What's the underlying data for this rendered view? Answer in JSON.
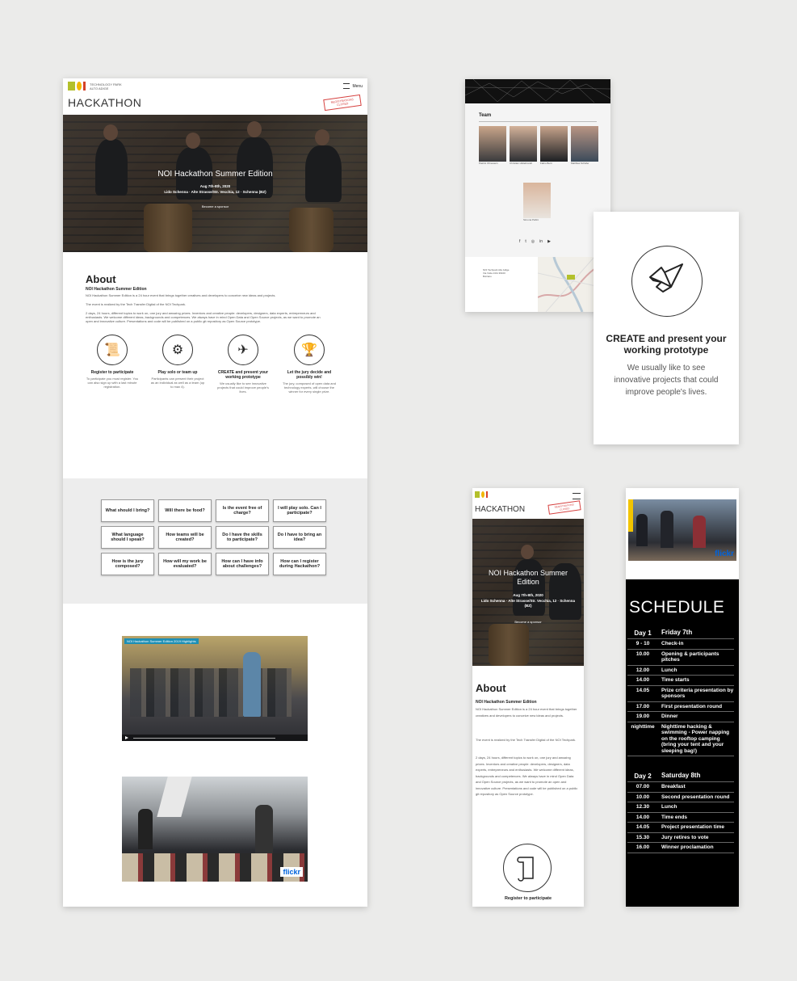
{
  "desktop": {
    "logo_text": "TECHNOLOGY PARK ALTO ADIGE",
    "menu_label": "Menu",
    "title": "HACKATHON",
    "stamp": "REGISTRATIONS CLOSED",
    "hero": {
      "headline": "NOI Hackathon Summer Edition",
      "date": "Aug 7th-8th, 2020",
      "location": "Lido Schenna · Alte Strasse/Str. Vecchia, 12 · Schenna (BZ)",
      "cta": "Become a sponsor"
    },
    "about": {
      "heading": "About",
      "subheading": "NOI Hackathon Summer Edition",
      "p1": "NOI Hackathon Summer Edition is a 24 hour event that brings together creatives and developers to conceive new ideas and projects.",
      "p2": "The event is realized by the Tech Transfer Digital of the NOI Techpark.",
      "p3": "2 days, 24 hours, different topics to work on, one jury and amazing prizes. Inventors and creative people: developers, designers, data experts, entrepreneurs and enthusiasts. We welcome different ideas, backgrounds and competences. We always have in mind Open Data and Open Source projects, as we want to promote an open and innovative culture. Presentations and code will be published on a public git repository as Open Source prototype."
    },
    "features": [
      {
        "icon": "scroll-icon",
        "glyph": "📜",
        "title": "Register to participate",
        "desc": "To participate you must register. You can also sign up with a last minute registration."
      },
      {
        "icon": "robot-icon",
        "glyph": "⚙",
        "title": "Play solo or team up",
        "desc": "Participants can present their project as an individual as well as a team (up to max 4)."
      },
      {
        "icon": "origami-bird-icon",
        "glyph": "✈",
        "title": "CREATE and present your working prototype",
        "desc": "We usually like to see innovative projects that could improve people's lives."
      },
      {
        "icon": "trophy-icon",
        "glyph": "🏆",
        "title": "Let the jury decide and possibly win!",
        "desc": "The jury, composed of open data and technology experts, will choose the winner for every single prize."
      }
    ],
    "faq": [
      "What should I bring?",
      "Will there be food?",
      "Is the event free of charge?",
      "I will play solo. Can I participate?",
      "What language should I speak?",
      "How teams will be created?",
      "Do I have the skills to participate?",
      "Do I have to bring an idea?",
      "How is the jury composed?",
      "How will my work be evaluated?",
      "How can I have info about challenges?",
      "How can I register during Hackathon?"
    ],
    "video_title": "NOI Hackathon Summer Edition 2019 Highlights",
    "flickr": "flickr"
  },
  "team": {
    "heading": "Team",
    "members": [
      "Patrick Ohnewein",
      "Christian Hildebrandt",
      "Fabio Berti",
      "Matthias Schäfer"
    ],
    "member5": "Simona Pellini",
    "address": "NOI Techpark Alto Adige Via Volta 13/A 39100 Bolzano"
  },
  "feature_card": {
    "icon": "origami-bird-icon",
    "title": "CREATE and present your working prototype",
    "desc": "We usually like to see innovative projects that could improve people's lives."
  },
  "mobile": {
    "title": "HACKATHON",
    "stamp": "REGISTRATIONS CLOSED",
    "headline": "NOI Hackathon Summer Edition",
    "date": "Aug 7th-8th, 2020",
    "location": "Lido Schenna · Alte Strasse/Str. Vecchia, 12 · Schenna (BZ)",
    "cta": "Become a sponsor",
    "about_heading": "About",
    "about_sub": "NOI Hackathon Summer Edition",
    "about_p1": "NOI Hackathon Summer Edition is a 24 hour event that brings together creatives and developers to conceive new ideas and projects.",
    "about_p2": "The event is realized by the Tech Transfer Digital of the NOI Techpark.",
    "about_p3": "2 days, 24 hours, different topics to work on, one jury and amazing prizes. Inventors and creative people: developers, designers, data experts, entrepreneurs and enthusiasts. We welcome different ideas, backgrounds and competences. We always have in mind Open Data and Open Source projects, as we want to promote an open and innovative culture. Presentations and code will be published on a public git repository as Open Source prototype.",
    "register_label": "Register to participate"
  },
  "schedule": {
    "flickr": "flickr",
    "heading": "SCHEDULE",
    "day1": {
      "label": "Day 1",
      "date": "Friday 7th"
    },
    "day1_rows": [
      {
        "time": "9 - 10",
        "event": "Check-in"
      },
      {
        "time": "10.00",
        "event": "Opening & participants pitches"
      },
      {
        "time": "12.00",
        "event": "Lunch"
      },
      {
        "time": "14.00",
        "event": "Time starts"
      },
      {
        "time": "14.05",
        "event": "Prize criteria presentation by sponsors"
      },
      {
        "time": "17.00",
        "event": "First presentation round"
      },
      {
        "time": "19.00",
        "event": "Dinner"
      },
      {
        "time": "nighttime",
        "event": "Nighttime hacking & swimming - Power napping on the rooftop camping (bring your tent and your sleeping bag!)"
      }
    ],
    "day2": {
      "label": "Day 2",
      "date": "Saturday 8th"
    },
    "day2_rows": [
      {
        "time": "07.00",
        "event": "Breakfast"
      },
      {
        "time": "10.00",
        "event": "Second presentation round"
      },
      {
        "time": "12.30",
        "event": "Lunch"
      },
      {
        "time": "14.00",
        "event": "Time ends"
      },
      {
        "time": "14.05",
        "event": "Project presentation time"
      },
      {
        "time": "15.30",
        "event": "Jury retires to vote"
      },
      {
        "time": "16.00",
        "event": "Winner proclamation"
      }
    ]
  }
}
